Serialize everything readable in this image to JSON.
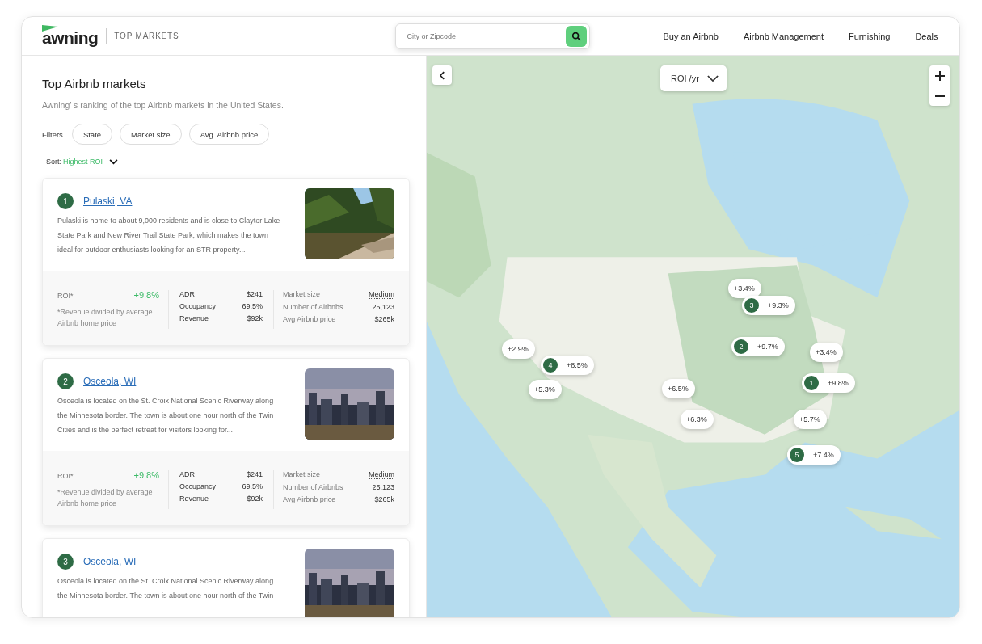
{
  "header": {
    "logo": "awning",
    "section": "TOP MARKETS",
    "search": {
      "placeholder": "City or Zipcode"
    },
    "nav": [
      "Buy an Airbnb",
      "Airbnb Management",
      "Furnishing",
      "Deals"
    ]
  },
  "panel": {
    "title": "Top Airbnb markets",
    "subtitle": "Awning’ s ranking of the top Airbnb markets in the United States.",
    "filters_label": "Filters",
    "filters": [
      "State",
      "Market size",
      "Avg. Airbnb price"
    ],
    "sort_label": "Sort:",
    "sort_value": "Highest ROI"
  },
  "markets": [
    {
      "rank": "1",
      "name": "Pulaski, VA",
      "description": "Pulaski is home to about 9,000 residents and is close to Claytor Lake State Park and New River Trail State Park, which makes the town ideal for outdoor enthusiasts looking for an STR property...",
      "stats": {
        "roi_label": "ROI*",
        "roi": "+9.8%",
        "note": "*Revenue divided by average Airbnb home price",
        "middle": [
          {
            "label": "ADR",
            "value": "$241"
          },
          {
            "label": "Occupancy",
            "value": "69.5%"
          },
          {
            "label": "Revenue",
            "value": "$92k"
          }
        ],
        "right": [
          {
            "label": "Market size",
            "value": "Medium",
            "dotted": true
          },
          {
            "label": "Number of Airbnbs",
            "value": "25,123",
            "dotted": false
          },
          {
            "label": "Avg Airbnb price",
            "value": "$265k",
            "dotted": false
          }
        ]
      }
    },
    {
      "rank": "2",
      "name": "Osceola, WI",
      "description": "Osceola is located on the St. Croix National Scenic Riverway along the Minnesota border. The town is about one hour north of the Twin Cities and is the perfect retreat for visitors looking for...",
      "stats": {
        "roi_label": "ROI*",
        "roi": "+9.8%",
        "note": "*Revenue divided by average Airbnb home price",
        "middle": [
          {
            "label": "ADR",
            "value": "$241"
          },
          {
            "label": "Occupancy",
            "value": "69.5%"
          },
          {
            "label": "Revenue",
            "value": "$92k"
          }
        ],
        "right": [
          {
            "label": "Market size",
            "value": "Medium",
            "dotted": true
          },
          {
            "label": "Number of Airbnbs",
            "value": "25,123",
            "dotted": false
          },
          {
            "label": "Avg Airbnb price",
            "value": "$265k",
            "dotted": false
          }
        ]
      }
    },
    {
      "rank": "3",
      "name": "Osceola, WI",
      "description": "Osceola is located on the St. Croix National Scenic Riverway along the Minnesota border. The town is about one hour north of the Twin"
    }
  ],
  "map": {
    "metric": "ROI /yr",
    "markers": [
      {
        "roi": "+3.4%"
      },
      {
        "rank": "3",
        "roi": "+9.3%"
      },
      {
        "rank": "2",
        "roi": "+9.7%"
      },
      {
        "roi": "+3.4%"
      },
      {
        "roi": "+2.9%"
      },
      {
        "rank": "4",
        "roi": "+8.5%"
      },
      {
        "roi": "+5.3%"
      },
      {
        "roi": "+6.5%"
      },
      {
        "rank": "1",
        "roi": "+9.8%"
      },
      {
        "roi": "+6.3%"
      },
      {
        "roi": "+5.7%"
      },
      {
        "rank": "5",
        "roi": "+7.4%"
      }
    ]
  }
}
